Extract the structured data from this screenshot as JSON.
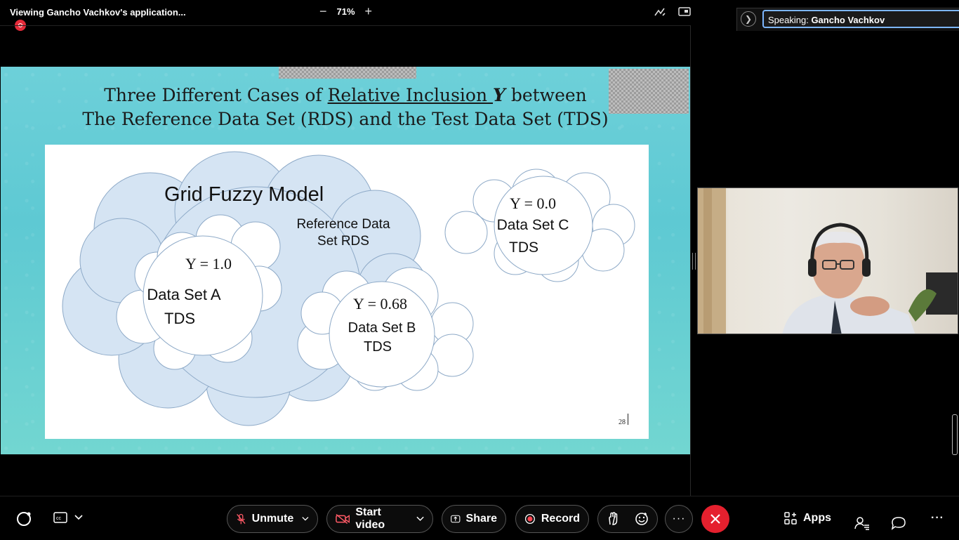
{
  "window": {
    "title": "Viewing Gancho Vachkov's application...",
    "zoom_minus": "−",
    "zoom_value": "71%",
    "zoom_plus": "+"
  },
  "slide": {
    "title_line1_pre": "Three Different Cases of ",
    "title_line1_underlined": "Relative Inclusion ",
    "title_line1_symbol": "Y",
    "title_line1_post": " between",
    "title_line2": "The Reference Data Set (RDS) and the Test Data Set (TDS)",
    "grid_label": "Grid Fuzzy Model",
    "rds_label_line1": "Reference Data",
    "rds_label_line2": "Set RDS",
    "set_a": {
      "y": "Y = 1.0",
      "name": "Data Set A",
      "tds": "TDS"
    },
    "set_b": {
      "y": "Y = 0.68",
      "name": "Data Set B",
      "tds": "TDS"
    },
    "set_c": {
      "y": "Y = 0.0",
      "name": "Data Set C",
      "tds": "TDS"
    },
    "page_number": "28"
  },
  "speaking": {
    "prefix": "Speaking: ",
    "name": "Gancho Vachkov"
  },
  "toolbar": {
    "unmute": "Unmute",
    "start_video": "Start video",
    "share": "Share",
    "record": "Record",
    "more": "···",
    "apps": "Apps",
    "overflow": "···"
  },
  "colors": {
    "end_call": "#e5202e",
    "focus_ring": "#7cb6ff",
    "cloud_fill": "#d5e4f3"
  }
}
